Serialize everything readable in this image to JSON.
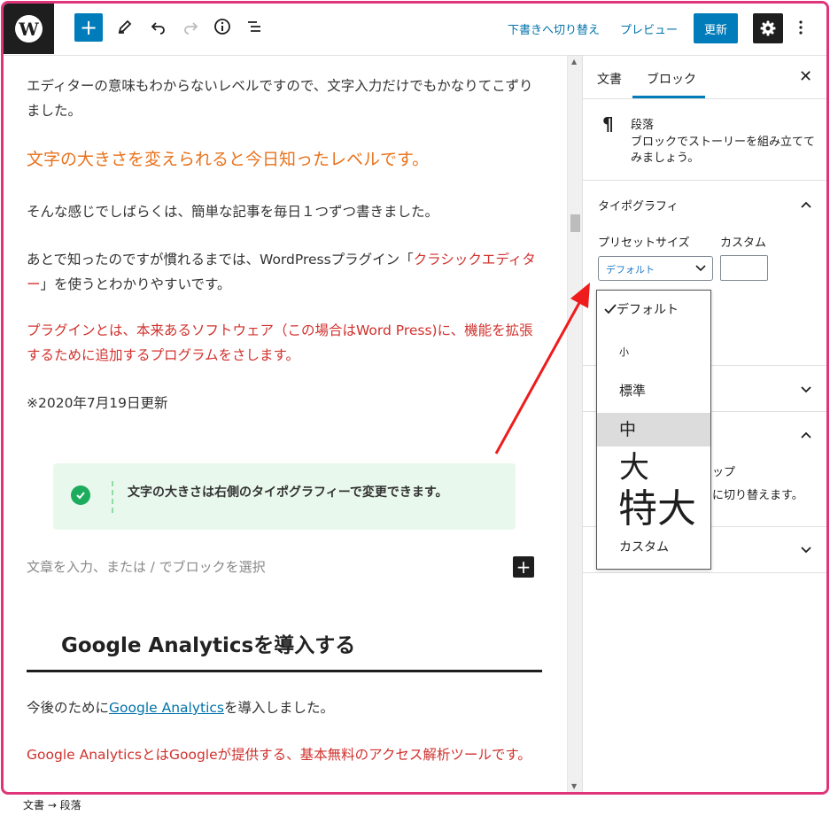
{
  "toolbar": {
    "switch_draft": "下書きへ切り替え",
    "preview": "プレビュー",
    "update": "更新",
    "wp_logo_letter": "W"
  },
  "editor": {
    "p1": "エディターの意味もわからないレベルですので、文字入力だけでもかなりてこずりました。",
    "h3": "文字の大きさを変えられると今日知ったレベルです。",
    "p2": "そんな感じでしばらくは、簡単な記事を毎日１つずつ書きました。",
    "p3_before": "あとで知ったのですが慣れるまでは、WordPressプラグイン「",
    "p3_highlight": "クラシックエディター",
    "p3_after": "」を使うとわかりやすいです。",
    "p4": "プラグインとは、本来あるソフトウェア（この場合はWord Press)に、機能を拡張するために追加するプログラムをさします。",
    "p5": "※2020年7月19日更新",
    "notice": "文字の大きさは右側のタイポグラフィーで変更できます。",
    "append_placeholder": "文章を入力、または / でブロックを選択",
    "h2": "Google Analyticsを導入する",
    "p6_before": "今後のために",
    "p6_link": "Google Analytics",
    "p6_after": "を導入しました。",
    "p7": "Google AnalyticsとはGoogleが提供する、基本無料のアクセス解析ツールです。"
  },
  "sidebar": {
    "tab_document": "文書",
    "tab_block": "ブロック",
    "block_title": "段落",
    "block_desc": "ブロックでストーリーを組み立ててみましょう。",
    "typography_title": "タイポグラフィ",
    "preset_label": "プリセットサイズ",
    "custom_label": "カスタム",
    "select_value": "デフォルト",
    "partial_text_1": "ップ",
    "partial_text_2": "に切り替えます。"
  },
  "dropdown": {
    "options": [
      "デフォルト",
      "小",
      "標準",
      "中",
      "大",
      "特大",
      "カスタム"
    ],
    "selected_index": 3,
    "checked_index": 0
  },
  "footer": {
    "breadcrumb": "文書 → 段落"
  },
  "colors": {
    "accent": "#007cba",
    "frame": "#e0347a",
    "annotation_arrow": "#ee1c1c",
    "heading_orange": "#e8721c",
    "text_red": "#d0312d"
  }
}
